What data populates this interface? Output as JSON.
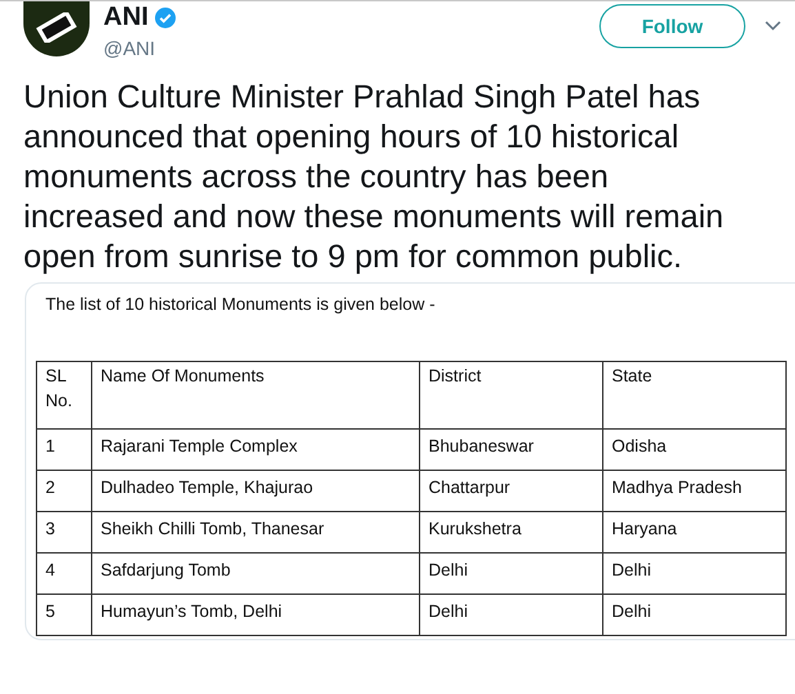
{
  "author": {
    "name": "ANI",
    "verified": true,
    "handle": "@ANI"
  },
  "follow_button": "Follow",
  "tweet_text": "Union Culture Minister Prahlad Singh Patel has announced that opening hours of 10 historical monuments across the country has been increased and now these monuments will remain open from sunrise to 9 pm for common public.",
  "document": {
    "intro": "The list of 10 historical Monuments is given below -",
    "table": {
      "columns": [
        "SL No.",
        "Name Of Monuments",
        "District",
        "State"
      ],
      "rows": [
        [
          "1",
          "Rajarani Temple Complex",
          "Bhubaneswar",
          "Odisha"
        ],
        [
          "2",
          "Dulhadeo Temple, Khajurao",
          "Chattarpur",
          "Madhya Pradesh"
        ],
        [
          "3",
          "Sheikh Chilli Tomb, Thanesar",
          "Kurukshetra",
          "Haryana"
        ],
        [
          "4",
          "Safdarjung Tomb",
          "Delhi",
          "Delhi"
        ],
        [
          "5",
          "Humayun’s Tomb, Delhi",
          "Delhi",
          "Delhi"
        ]
      ]
    }
  }
}
